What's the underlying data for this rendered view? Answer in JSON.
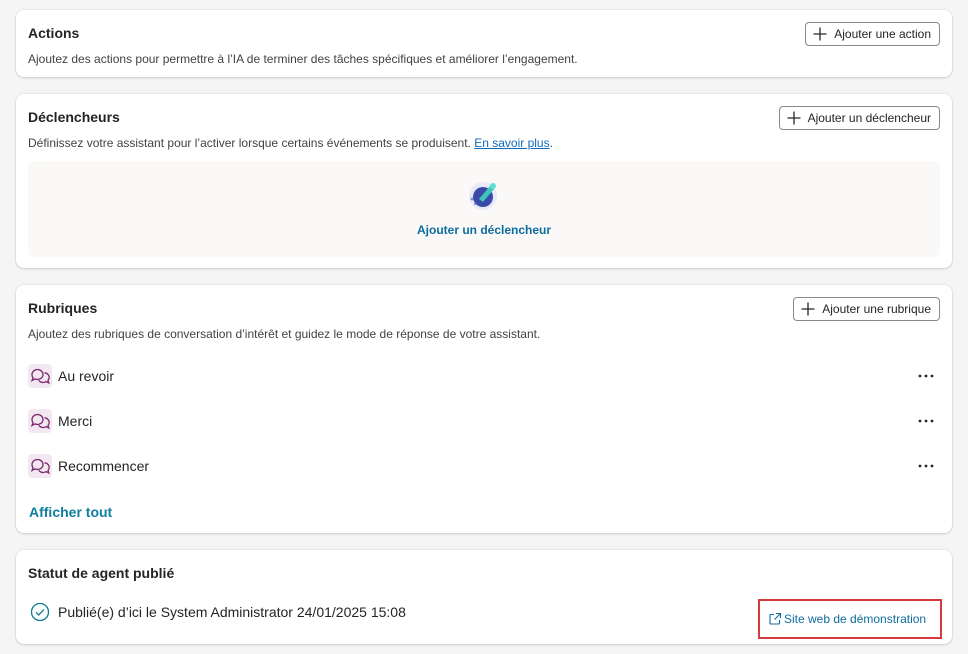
{
  "actions": {
    "title": "Actions",
    "description": "Ajoutez des actions pour permettre à l’IA de terminer des tâches spécifiques et améliorer l’engagement.",
    "add_label": "Ajouter une action"
  },
  "triggers": {
    "title": "Déclencheurs",
    "description": "Définissez votre assistant pour l’activer lorsque certains événements se produisent.",
    "learn_more": "En savoir plus",
    "learn_more_suffix": ".",
    "add_label": "Ajouter un déclencheur",
    "empty_link": "Ajouter un déclencheur",
    "illustration_icon": "trigger-spark-icon"
  },
  "topics": {
    "title": "Rubriques",
    "description": "Ajoutez des rubriques de conversation d’intérêt et guidez le mode de réponse de votre assistant.",
    "add_label": "Ajouter une rubrique",
    "items": [
      {
        "label": "Au revoir"
      },
      {
        "label": "Merci"
      },
      {
        "label": "Recommencer"
      }
    ],
    "show_all": "Afficher tout",
    "item_icon": "chat-bubbles-icon",
    "more_icon": "more-horizontal-icon"
  },
  "publish": {
    "title": "Statut de agent publié",
    "status": "Publié(e) d’ici le System Administrator 24/01/2025 15:08",
    "demo_link": "Site web de démonstration",
    "status_icon": "check-circle-icon",
    "link_icon": "open-external-icon"
  },
  "colors": {
    "accent": "#0f6c9e",
    "topic_icon": "#7a2a6e",
    "highlight": "#d63b3b"
  }
}
